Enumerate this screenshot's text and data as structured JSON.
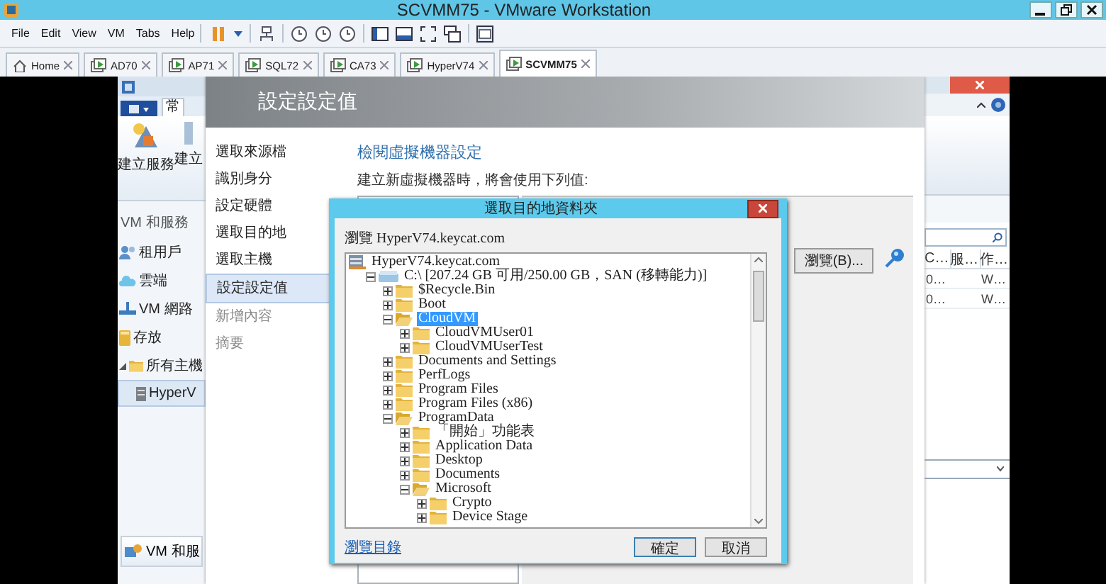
{
  "window": {
    "title": "SCVMM75 - VMware Workstation"
  },
  "menu": [
    "File",
    "Edit",
    "View",
    "VM",
    "Tabs",
    "Help"
  ],
  "tabs": [
    {
      "label": "Home",
      "kind": "home",
      "selected": false
    },
    {
      "label": "AD70",
      "kind": "vm",
      "selected": false
    },
    {
      "label": "AP71",
      "kind": "vm",
      "selected": false
    },
    {
      "label": "SQL72",
      "kind": "vm",
      "selected": false
    },
    {
      "label": "CA73",
      "kind": "vm",
      "selected": false
    },
    {
      "label": "HyperV74",
      "kind": "vm",
      "selected": false
    },
    {
      "label": "SCVMM75",
      "kind": "vm",
      "selected": true
    }
  ],
  "console": {
    "ribbon_tab": "常",
    "ribbon_buttons": [
      "建立服務",
      "建立"
    ],
    "nav_header": "VM 和服務",
    "nav_items": [
      {
        "label": "租用戶",
        "kind": "tenant"
      },
      {
        "label": "雲端",
        "kind": "cloud"
      },
      {
        "label": "VM 網路",
        "kind": "network"
      },
      {
        "label": "存放",
        "kind": "storage"
      },
      {
        "label": "所有主機",
        "kind": "hosts",
        "expanded": true,
        "children": [
          {
            "label": "HyperV",
            "kind": "server",
            "selected": true
          }
        ]
      }
    ],
    "nav_bottom": "VM 和服",
    "columns": [
      "C…",
      "服…",
      "作…"
    ],
    "rows": [
      {
        "column_1": "0…",
        "column_3": "W…"
      },
      {
        "column_1": "0…",
        "column_3": "W…"
      }
    ]
  },
  "wizard": {
    "title": "設定設定值",
    "steps": [
      {
        "label": "選取來源檔",
        "selected": false,
        "disabled": false
      },
      {
        "label": "識別身分",
        "selected": false,
        "disabled": false
      },
      {
        "label": "設定硬體",
        "selected": false,
        "disabled": false
      },
      {
        "label": "選取目的地",
        "selected": false,
        "disabled": false
      },
      {
        "label": "選取主機",
        "selected": false,
        "disabled": false
      },
      {
        "label": "設定設定值",
        "selected": true,
        "disabled": false
      },
      {
        "label": "新增內容",
        "selected": false,
        "disabled": true
      },
      {
        "label": "摘要",
        "selected": false,
        "disabled": true
      }
    ],
    "heading": "檢閱虛擬機器設定",
    "intro": "建立新虛擬機器時，將會使用下列值:",
    "browse_button": "瀏覽(B)..."
  },
  "dialog": {
    "title": "選取目的地資料夾",
    "browse_label": "瀏覽 HyperV74.keycat.com",
    "tree": [
      {
        "label": "HyperV74.keycat.com",
        "kind": "server",
        "children": [
          {
            "label": "C:\\ [207.24 GB 可用/250.00 GB，SAN (移轉能力)]",
            "kind": "drive",
            "expanded": true,
            "children": [
              {
                "label": "$Recycle.Bin",
                "kind": "folder",
                "expanded": false,
                "selected": false
              },
              {
                "label": "Boot",
                "kind": "folder",
                "expanded": false,
                "selected": false
              },
              {
                "label": "CloudVM",
                "kind": "folder",
                "expanded": true,
                "selected": true,
                "children": [
                  {
                    "label": "CloudVMUser01",
                    "kind": "folder",
                    "expanded": false,
                    "selected": false
                  },
                  {
                    "label": "CloudVMUserTest",
                    "kind": "folder",
                    "expanded": false,
                    "selected": false
                  }
                ]
              },
              {
                "label": "Documents and Settings",
                "kind": "folder",
                "expanded": false,
                "selected": false
              },
              {
                "label": "PerfLogs",
                "kind": "folder",
                "expanded": false,
                "selected": false
              },
              {
                "label": "Program Files",
                "kind": "folder",
                "expanded": false,
                "selected": false
              },
              {
                "label": "Program Files (x86)",
                "kind": "folder",
                "expanded": false,
                "selected": false
              },
              {
                "label": "ProgramData",
                "kind": "folder",
                "expanded": true,
                "selected": false,
                "children": [
                  {
                    "label": "「開始」功能表",
                    "kind": "folder",
                    "expanded": false,
                    "selected": false
                  },
                  {
                    "label": "Application Data",
                    "kind": "folder",
                    "expanded": false,
                    "selected": false
                  },
                  {
                    "label": "Desktop",
                    "kind": "folder",
                    "expanded": false,
                    "selected": false
                  },
                  {
                    "label": "Documents",
                    "kind": "folder",
                    "expanded": false,
                    "selected": false
                  },
                  {
                    "label": "Microsoft",
                    "kind": "folder",
                    "expanded": true,
                    "selected": false,
                    "children": [
                      {
                        "label": "Crypto",
                        "kind": "folder",
                        "expanded": false,
                        "selected": false
                      },
                      {
                        "label": "Device Stage",
                        "kind": "folder",
                        "expanded": false,
                        "selected": false
                      }
                    ]
                  }
                ]
              }
            ]
          }
        ]
      }
    ],
    "link": "瀏覽目錄",
    "ok_button": "確定",
    "cancel_button": "取消"
  }
}
